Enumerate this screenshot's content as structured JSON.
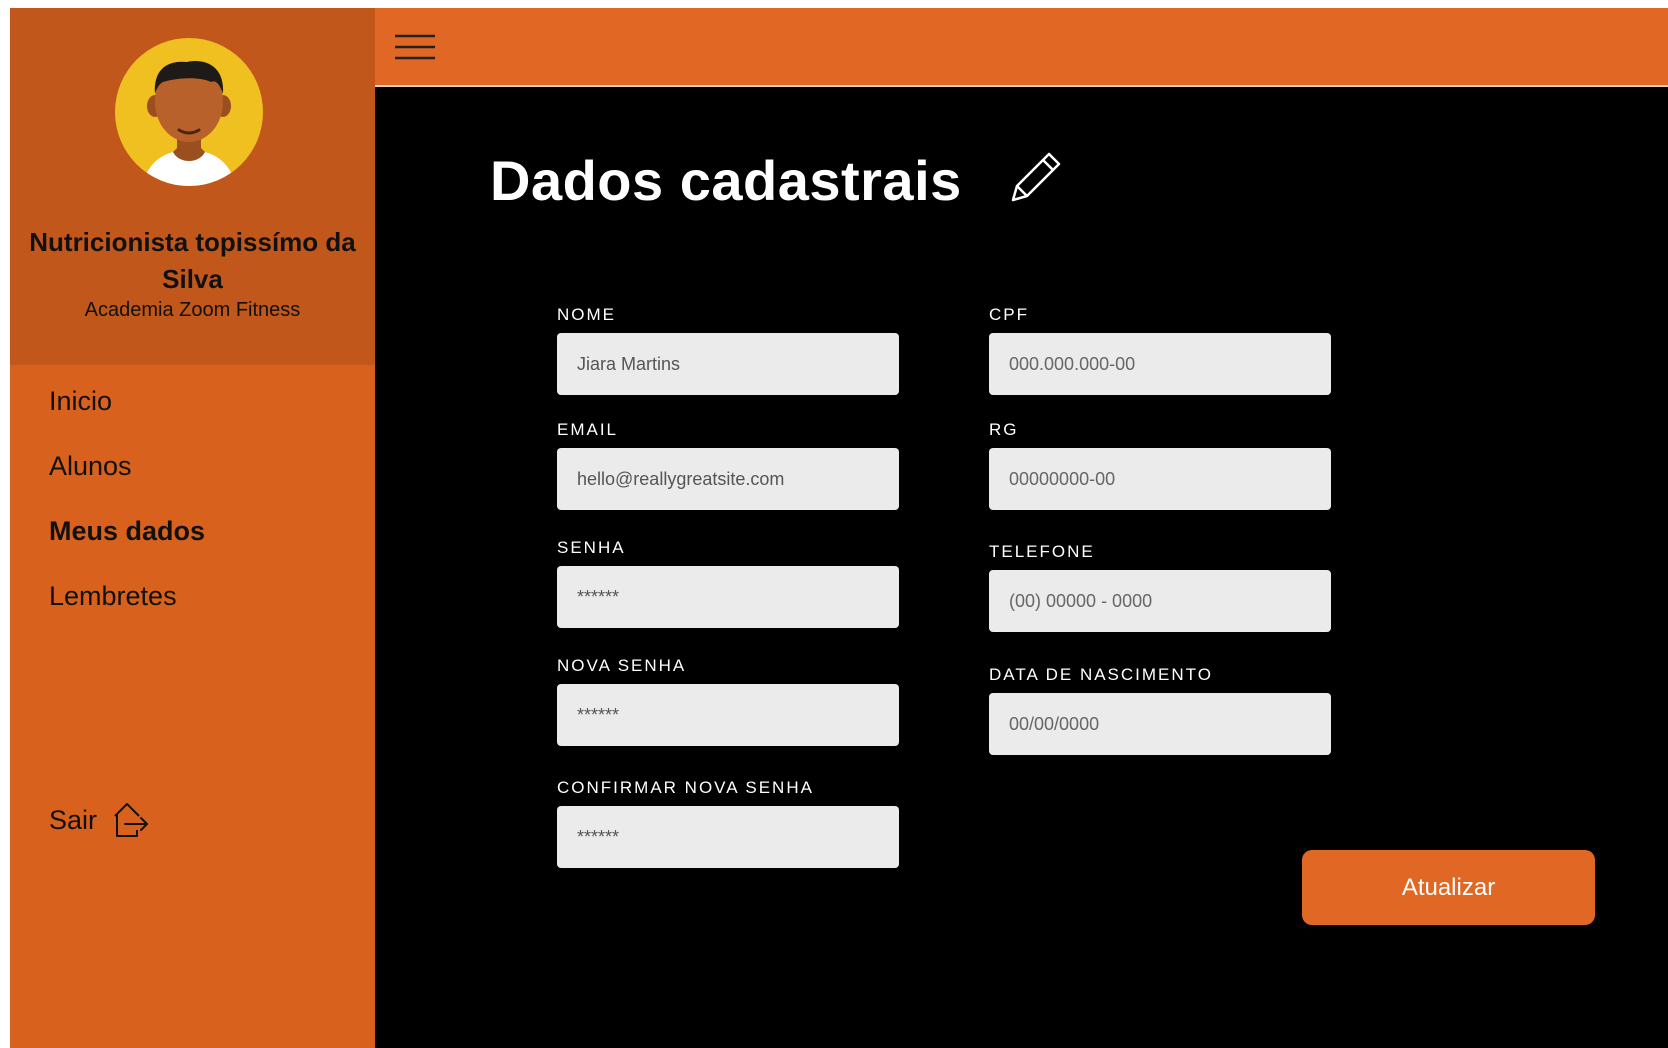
{
  "profile": {
    "name": "Nutricionista topissímo da Silva",
    "organization": "Academia Zoom Fitness"
  },
  "nav": {
    "items": [
      {
        "label": "Inicio",
        "active": false
      },
      {
        "label": "Alunos",
        "active": false
      },
      {
        "label": "Meus dados",
        "active": true
      },
      {
        "label": "Lembretes",
        "active": false
      }
    ],
    "logout_label": "Sair"
  },
  "page": {
    "title": "Dados cadastrais"
  },
  "form": {
    "nome": {
      "label": "NOME",
      "value": "Jiara Martins",
      "placeholder": ""
    },
    "email": {
      "label": "EMAIL",
      "value": "hello@reallygreatsite.com",
      "placeholder": ""
    },
    "senha": {
      "label": "SENHA",
      "value": "******",
      "placeholder": ""
    },
    "nova_senha": {
      "label": "NOVA SENHA",
      "value": "******",
      "placeholder": ""
    },
    "confirmar_nova_senha": {
      "label": "CONFIRMAR NOVA SENHA",
      "value": "******",
      "placeholder": ""
    },
    "cpf": {
      "label": "CPF",
      "value": "",
      "placeholder": "000.000.000-00"
    },
    "rg": {
      "label": "RG",
      "value": "",
      "placeholder": "00000000-00"
    },
    "telefone": {
      "label": "TELEFONE",
      "value": "",
      "placeholder": "(00) 00000 - 0000"
    },
    "data_nascimento": {
      "label": "DATA DE NASCIMENTO",
      "value": "",
      "placeholder": "00/00/0000"
    },
    "submit_label": "Atualizar"
  },
  "colors": {
    "sidebar": "#d8611d",
    "profile_panel": "#c1571a",
    "topbar": "#e06824",
    "main_bg": "#000000",
    "input_bg": "#ebebeb",
    "avatar_bg": "#f0c020"
  },
  "icons": {
    "menu": "hamburger-menu-icon",
    "edit": "pencil-icon",
    "logout": "logout-icon"
  }
}
